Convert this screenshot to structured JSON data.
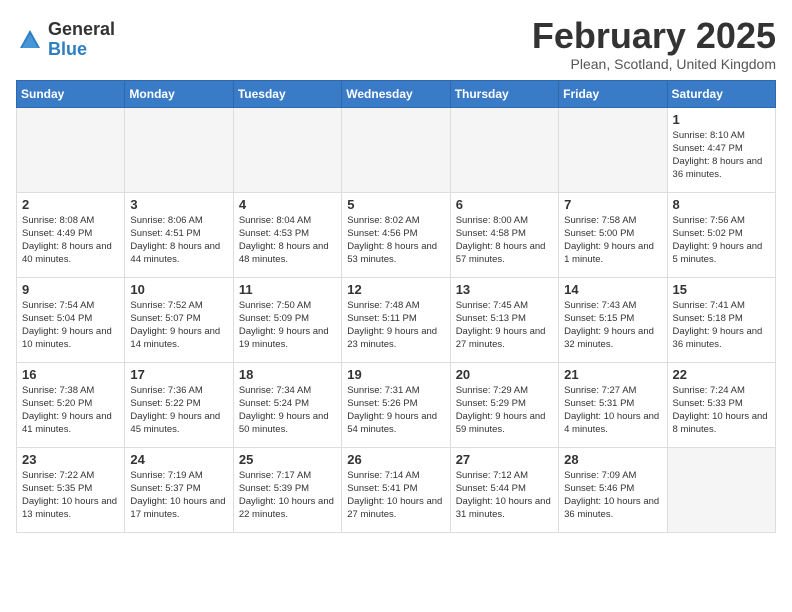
{
  "logo": {
    "general": "General",
    "blue": "Blue"
  },
  "title": "February 2025",
  "subtitle": "Plean, Scotland, United Kingdom",
  "days_of_week": [
    "Sunday",
    "Monday",
    "Tuesday",
    "Wednesday",
    "Thursday",
    "Friday",
    "Saturday"
  ],
  "weeks": [
    [
      {
        "day": "",
        "info": ""
      },
      {
        "day": "",
        "info": ""
      },
      {
        "day": "",
        "info": ""
      },
      {
        "day": "",
        "info": ""
      },
      {
        "day": "",
        "info": ""
      },
      {
        "day": "",
        "info": ""
      },
      {
        "day": "1",
        "info": "Sunrise: 8:10 AM\nSunset: 4:47 PM\nDaylight: 8 hours and 36 minutes."
      }
    ],
    [
      {
        "day": "2",
        "info": "Sunrise: 8:08 AM\nSunset: 4:49 PM\nDaylight: 8 hours and 40 minutes."
      },
      {
        "day": "3",
        "info": "Sunrise: 8:06 AM\nSunset: 4:51 PM\nDaylight: 8 hours and 44 minutes."
      },
      {
        "day": "4",
        "info": "Sunrise: 8:04 AM\nSunset: 4:53 PM\nDaylight: 8 hours and 48 minutes."
      },
      {
        "day": "5",
        "info": "Sunrise: 8:02 AM\nSunset: 4:56 PM\nDaylight: 8 hours and 53 minutes."
      },
      {
        "day": "6",
        "info": "Sunrise: 8:00 AM\nSunset: 4:58 PM\nDaylight: 8 hours and 57 minutes."
      },
      {
        "day": "7",
        "info": "Sunrise: 7:58 AM\nSunset: 5:00 PM\nDaylight: 9 hours and 1 minute."
      },
      {
        "day": "8",
        "info": "Sunrise: 7:56 AM\nSunset: 5:02 PM\nDaylight: 9 hours and 5 minutes."
      }
    ],
    [
      {
        "day": "9",
        "info": "Sunrise: 7:54 AM\nSunset: 5:04 PM\nDaylight: 9 hours and 10 minutes."
      },
      {
        "day": "10",
        "info": "Sunrise: 7:52 AM\nSunset: 5:07 PM\nDaylight: 9 hours and 14 minutes."
      },
      {
        "day": "11",
        "info": "Sunrise: 7:50 AM\nSunset: 5:09 PM\nDaylight: 9 hours and 19 minutes."
      },
      {
        "day": "12",
        "info": "Sunrise: 7:48 AM\nSunset: 5:11 PM\nDaylight: 9 hours and 23 minutes."
      },
      {
        "day": "13",
        "info": "Sunrise: 7:45 AM\nSunset: 5:13 PM\nDaylight: 9 hours and 27 minutes."
      },
      {
        "day": "14",
        "info": "Sunrise: 7:43 AM\nSunset: 5:15 PM\nDaylight: 9 hours and 32 minutes."
      },
      {
        "day": "15",
        "info": "Sunrise: 7:41 AM\nSunset: 5:18 PM\nDaylight: 9 hours and 36 minutes."
      }
    ],
    [
      {
        "day": "16",
        "info": "Sunrise: 7:38 AM\nSunset: 5:20 PM\nDaylight: 9 hours and 41 minutes."
      },
      {
        "day": "17",
        "info": "Sunrise: 7:36 AM\nSunset: 5:22 PM\nDaylight: 9 hours and 45 minutes."
      },
      {
        "day": "18",
        "info": "Sunrise: 7:34 AM\nSunset: 5:24 PM\nDaylight: 9 hours and 50 minutes."
      },
      {
        "day": "19",
        "info": "Sunrise: 7:31 AM\nSunset: 5:26 PM\nDaylight: 9 hours and 54 minutes."
      },
      {
        "day": "20",
        "info": "Sunrise: 7:29 AM\nSunset: 5:29 PM\nDaylight: 9 hours and 59 minutes."
      },
      {
        "day": "21",
        "info": "Sunrise: 7:27 AM\nSunset: 5:31 PM\nDaylight: 10 hours and 4 minutes."
      },
      {
        "day": "22",
        "info": "Sunrise: 7:24 AM\nSunset: 5:33 PM\nDaylight: 10 hours and 8 minutes."
      }
    ],
    [
      {
        "day": "23",
        "info": "Sunrise: 7:22 AM\nSunset: 5:35 PM\nDaylight: 10 hours and 13 minutes."
      },
      {
        "day": "24",
        "info": "Sunrise: 7:19 AM\nSunset: 5:37 PM\nDaylight: 10 hours and 17 minutes."
      },
      {
        "day": "25",
        "info": "Sunrise: 7:17 AM\nSunset: 5:39 PM\nDaylight: 10 hours and 22 minutes."
      },
      {
        "day": "26",
        "info": "Sunrise: 7:14 AM\nSunset: 5:41 PM\nDaylight: 10 hours and 27 minutes."
      },
      {
        "day": "27",
        "info": "Sunrise: 7:12 AM\nSunset: 5:44 PM\nDaylight: 10 hours and 31 minutes."
      },
      {
        "day": "28",
        "info": "Sunrise: 7:09 AM\nSunset: 5:46 PM\nDaylight: 10 hours and 36 minutes."
      },
      {
        "day": "",
        "info": ""
      }
    ]
  ]
}
